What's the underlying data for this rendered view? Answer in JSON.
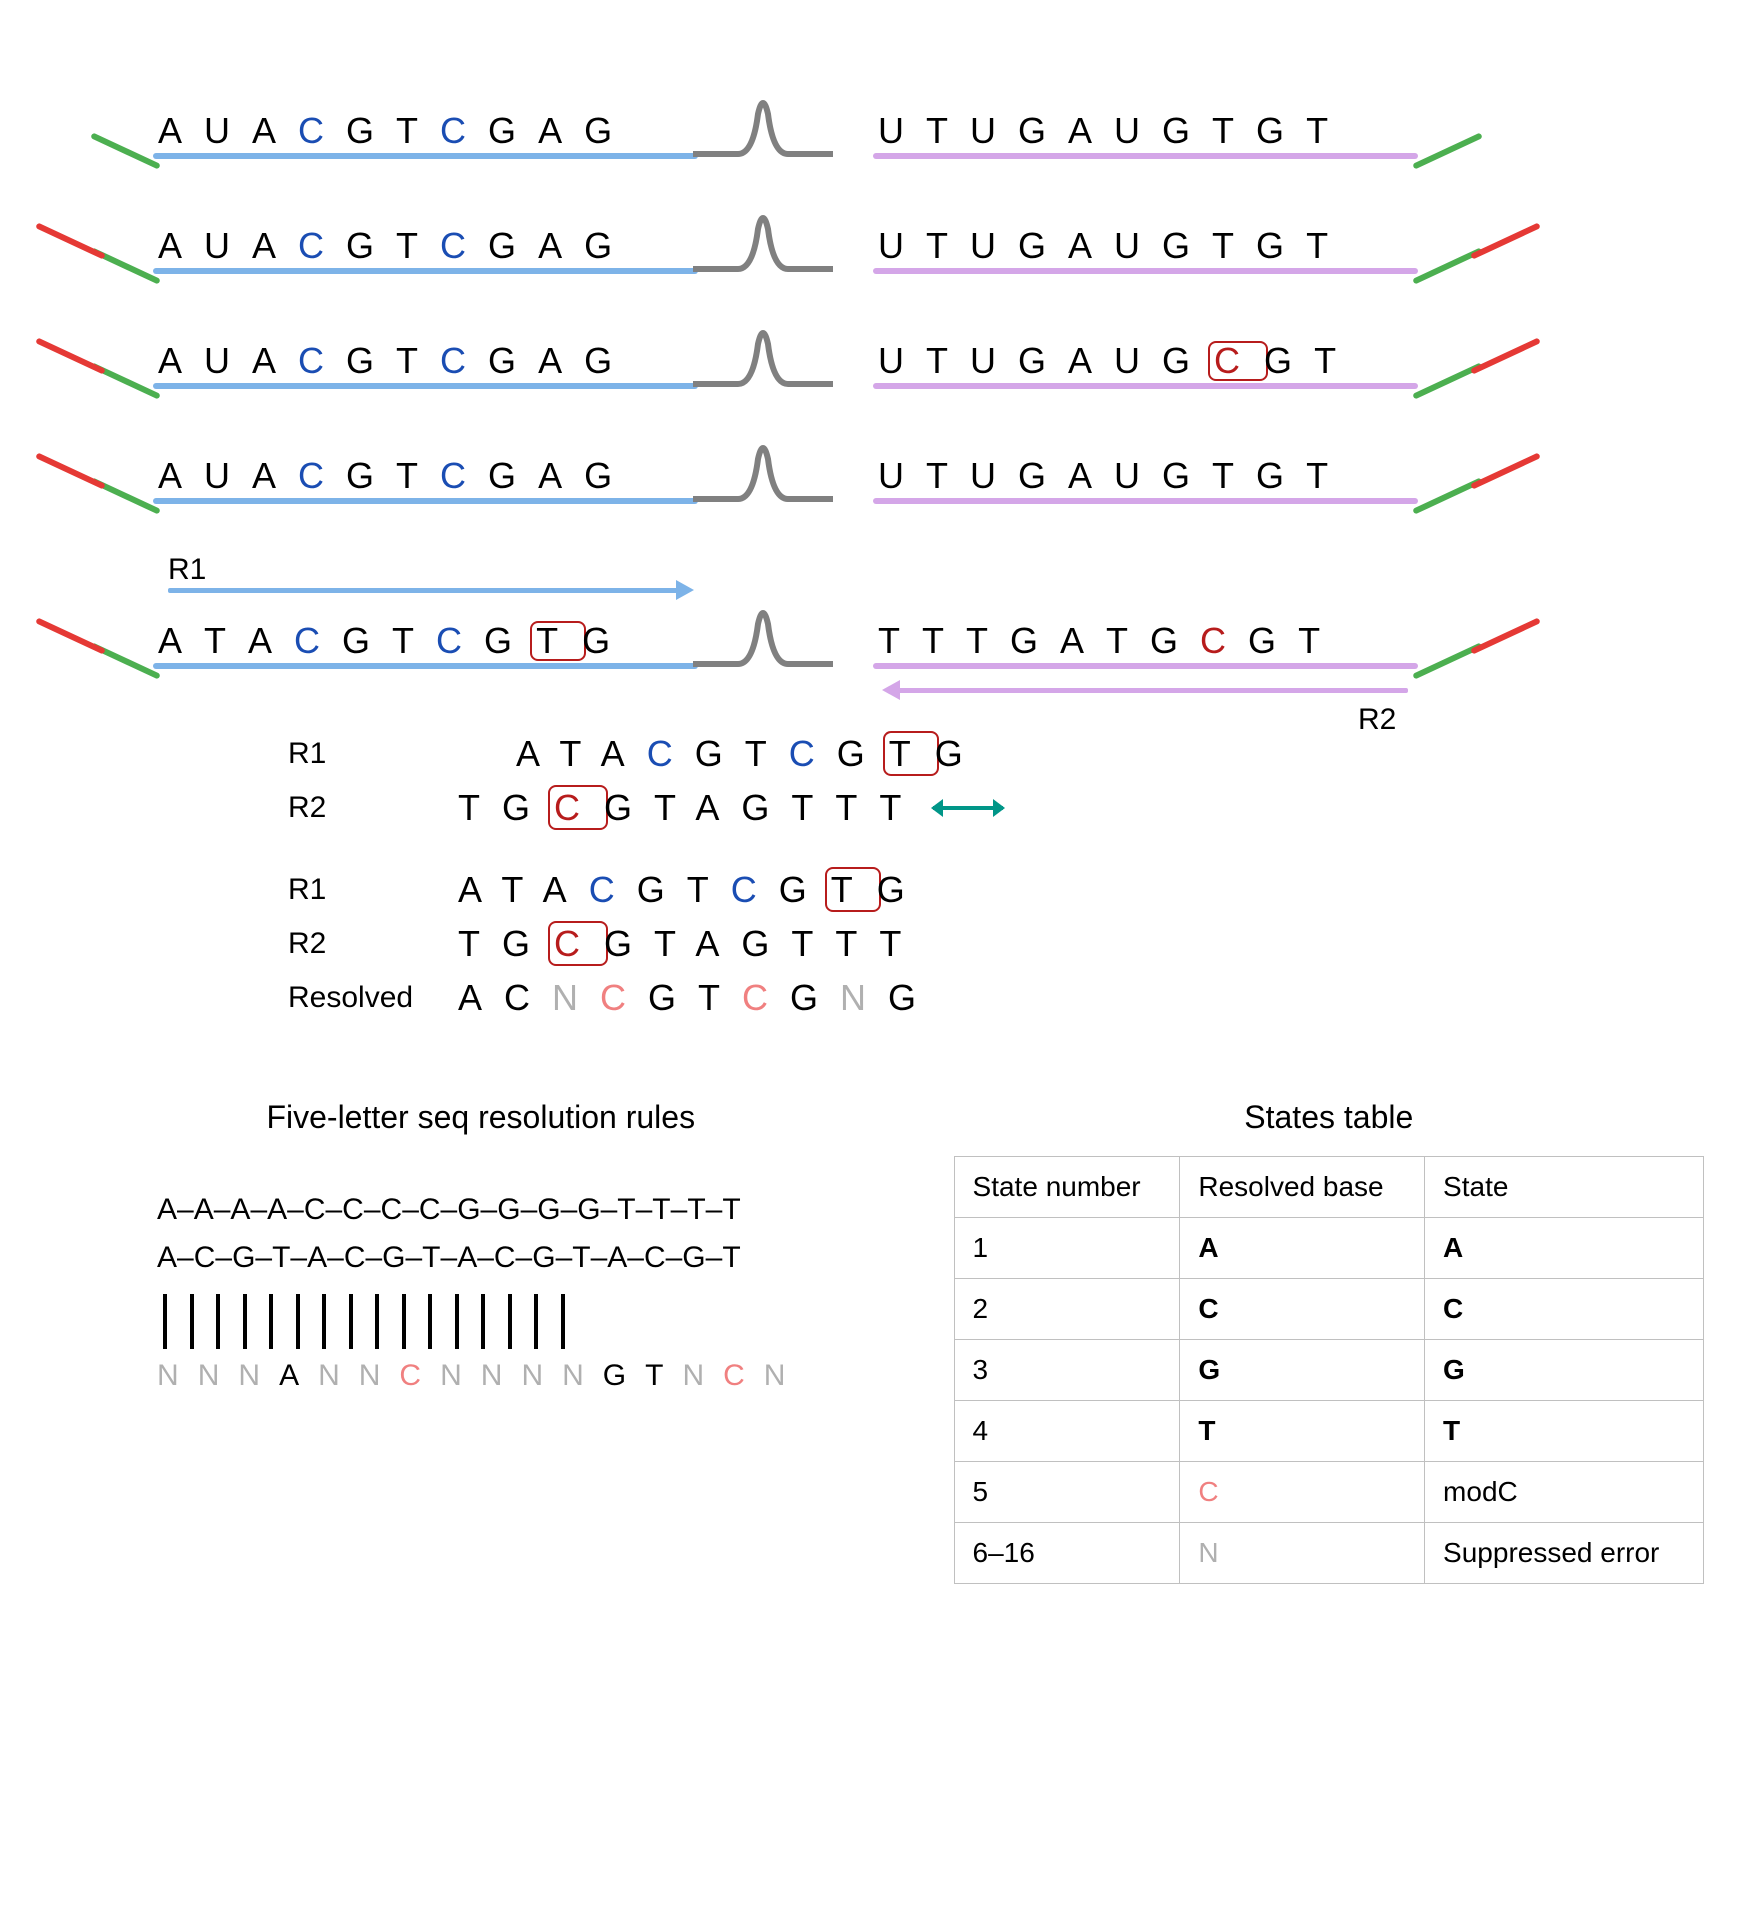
{
  "sequences": {
    "top_row_left": [
      "A",
      "U",
      "A",
      "C",
      "G",
      "T",
      "C",
      "G",
      "A",
      "G"
    ],
    "top_row_right": [
      "U",
      "T",
      "U",
      "G",
      "A",
      "U",
      "G",
      "T",
      "G",
      "T"
    ],
    "row3_right_variant": [
      "U",
      "T",
      "U",
      "G",
      "A",
      "U",
      "G",
      "C",
      "G",
      "T"
    ],
    "r1_left": [
      "A",
      "T",
      "A",
      "C",
      "G",
      "T",
      "C",
      "G",
      "T",
      "G"
    ],
    "r2_right": [
      "T",
      "T",
      "T",
      "G",
      "A",
      "T",
      "G",
      "C",
      "G",
      "T"
    ],
    "r1_label": "R1",
    "r2_label": "R2",
    "alignA_r1": [
      "A",
      "T",
      "A",
      "C",
      "G",
      "T",
      "C",
      "G",
      "T",
      "G"
    ],
    "alignA_r2": [
      "T",
      "G",
      "C",
      "G",
      "T",
      "A",
      "G",
      "T",
      "T",
      "T"
    ],
    "alignB_r1": [
      "A",
      "T",
      "A",
      "C",
      "G",
      "T",
      "C",
      "G",
      "T",
      "G"
    ],
    "alignB_r2": [
      "T",
      "G",
      "C",
      "G",
      "T",
      "A",
      "G",
      "T",
      "T",
      "T"
    ],
    "resolved": [
      "A",
      "C",
      "N",
      "C",
      "G",
      "T",
      "C",
      "G",
      "N",
      "G"
    ],
    "resolved_label": "Resolved"
  },
  "rules": {
    "title": "Five-letter seq resolution rules",
    "line1": "A–A–A–A–C–C–C–C–G–G–G–G–T–T–T–T",
    "line2": "A–C–G–T–A–C–G–T–A–C–G–T–A–C–G–T",
    "result": [
      "N",
      "N",
      "N",
      "A",
      "N",
      "N",
      "C",
      "N",
      "N",
      "N",
      "N",
      "G",
      "T",
      "N",
      "C",
      "N"
    ]
  },
  "states": {
    "title": "States table",
    "headers": [
      "State number",
      "Resolved base",
      "State"
    ],
    "rows": [
      {
        "num": "1",
        "base": "A",
        "basecolor": "black",
        "state": "A",
        "bold": true
      },
      {
        "num": "2",
        "base": "C",
        "basecolor": "black",
        "state": "C",
        "bold": true
      },
      {
        "num": "3",
        "base": "G",
        "basecolor": "black",
        "state": "G",
        "bold": true
      },
      {
        "num": "4",
        "base": "T",
        "basecolor": "black",
        "state": "T",
        "bold": true
      },
      {
        "num": "5",
        "base": "C",
        "basecolor": "coral",
        "state": "modC",
        "bold": false
      },
      {
        "num": "6–16",
        "base": "N",
        "basecolor": "gray",
        "state": "Suppressed error",
        "bold": false
      }
    ]
  },
  "chart_data": {
    "type": "table",
    "title": "States table",
    "columns": [
      "State number",
      "Resolved base",
      "State"
    ],
    "rows": [
      [
        "1",
        "A",
        "A"
      ],
      [
        "2",
        "C",
        "C"
      ],
      [
        "3",
        "G",
        "G"
      ],
      [
        "4",
        "T",
        "T"
      ],
      [
        "5",
        "C (modified)",
        "modC"
      ],
      [
        "6–16",
        "N",
        "Suppressed error"
      ]
    ]
  }
}
